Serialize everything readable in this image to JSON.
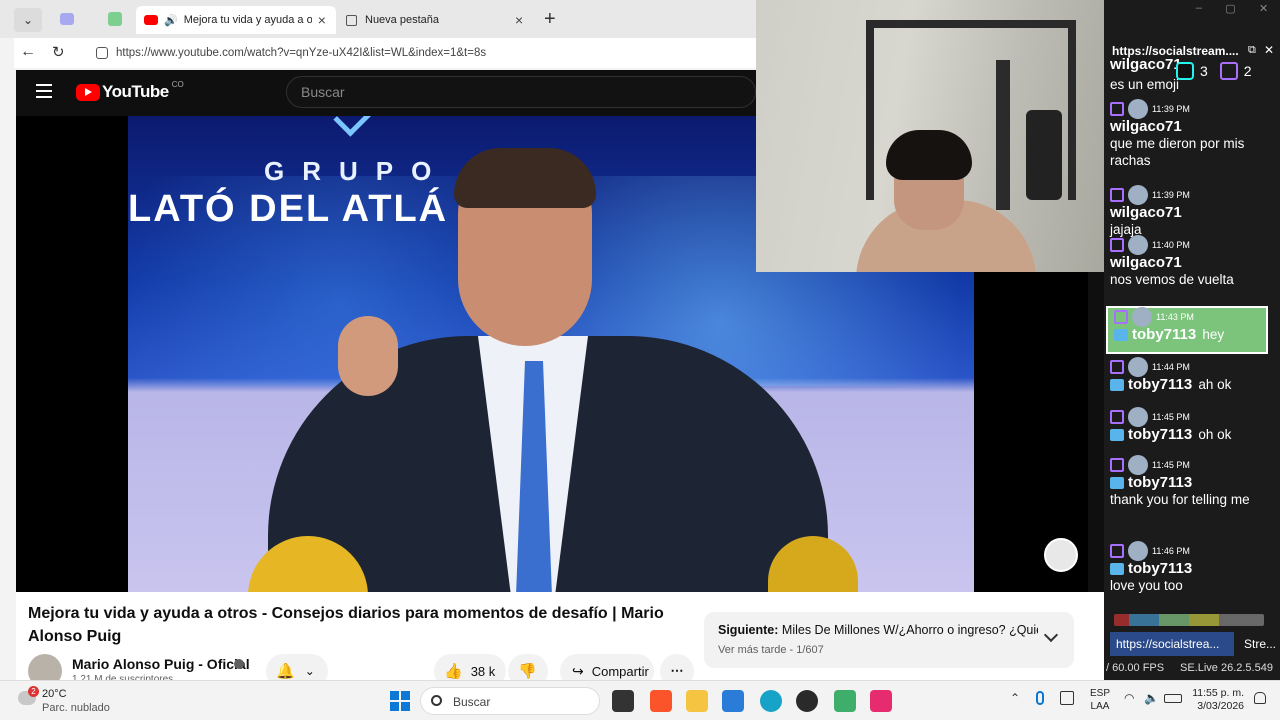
{
  "browser": {
    "tabs": [
      {
        "title": "Mejora tu vida y ayuda a otros",
        "active": true
      },
      {
        "title": "Nueva pestaña",
        "active": false
      }
    ],
    "url": "https://www.youtube.com/watch?v=qnYze-uX42I&list=WL&index=1&t=8s"
  },
  "youtube": {
    "logo": "YouTube",
    "country": "CO",
    "search_placeholder": "Buscar",
    "video_overlay_line1": "GRUPO",
    "video_overlay_line2": "LATÓ DEL ATLÁ    O",
    "title": "Mejora tu vida y ayuda a otros - Consejos diarios para momentos de desafío | Mario Alonso Puig",
    "channel": "Mario Alonso Puig - Oficial",
    "subscribers": "1,21 M de suscriptores",
    "likes": "38 k",
    "share_label": "Compartir",
    "next_label": "Siguiente:",
    "next_title": "Miles De Millones W/¿Ahorro o ingreso? ¿Quién...",
    "next_sub": "Ver más tarde - 1/607"
  },
  "chat": {
    "header_url": "https://socialstream....",
    "tiktok_count": "3",
    "twitch_count": "2",
    "top_user": "wilgaco71",
    "top_text": "es un emoji",
    "messages": [
      {
        "time": "11:39 PM",
        "user": "wilgaco71",
        "text": "que me dieron por mis rachas",
        "highlight": false
      },
      {
        "time": "11:39 PM",
        "user": "wilgaco71",
        "text": "jajaja",
        "highlight": false
      },
      {
        "time": "11:40 PM",
        "user": "wilgaco71",
        "text": "nos vemos de vuelta",
        "highlight": false
      },
      {
        "time": "11:43 PM",
        "user": "toby7113",
        "text": "hey",
        "highlight": true
      },
      {
        "time": "11:44 PM",
        "user": "toby7113",
        "text": "ah ok",
        "highlight": false
      },
      {
        "time": "11:45 PM",
        "user": "toby7113",
        "text": "oh ok",
        "highlight": false
      },
      {
        "time": "11:45 PM",
        "user": "toby7113",
        "text": "thank you for telling me",
        "highlight": false
      },
      {
        "time": "11:46 PM",
        "user": "toby7113",
        "text": "love you too",
        "highlight": false
      }
    ],
    "bottom_tab1": "https://socialstrea...",
    "bottom_tab2": "Stre...",
    "fps": "/ 60.00 FPS",
    "version": "SE.Live 26.2.5.549"
  },
  "taskbar": {
    "weather_temp": "20°C",
    "weather_desc": "Parc. nublado",
    "weather_badge": "2",
    "search_label": "Buscar",
    "lang1": "ESP",
    "lang2": "LAA",
    "time": "11:55 p. m.",
    "date": "3/03/2026"
  },
  "colors": {
    "youtube_red": "#ff0000",
    "twitch": "#a970ff",
    "highlight": "#7cc47c"
  }
}
